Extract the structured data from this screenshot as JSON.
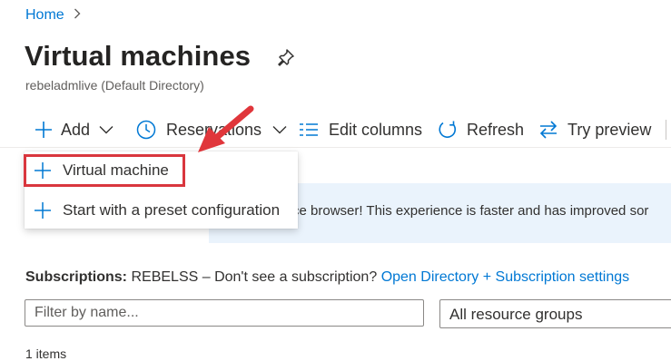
{
  "breadcrumb": {
    "home": "Home"
  },
  "page": {
    "title": "Virtual machines",
    "subtitle": "rebeladmlive (Default Directory)"
  },
  "toolbar": {
    "add_label": "Add",
    "reservations_label": "Reservations",
    "edit_columns_label": "Edit columns",
    "refresh_label": "Refresh",
    "try_preview_label": "Try preview"
  },
  "add_menu": {
    "items": [
      {
        "label": "Virtual machine"
      },
      {
        "label": "Start with a preset configuration"
      }
    ]
  },
  "banner": {
    "text": "ce browser! This experience is faster and has improved sor"
  },
  "subscriptions": {
    "label": "Subscriptions:",
    "text": "REBELSS – Don't see a subscription?",
    "link": "Open Directory + Subscription settings"
  },
  "filters": {
    "name_placeholder": "Filter by name...",
    "resource_group": "All resource groups"
  },
  "results": {
    "count_text": "1 items"
  },
  "colors": {
    "accent": "#0078d4",
    "highlight": "#d9363e",
    "banner_bg": "#eaf3fc"
  }
}
